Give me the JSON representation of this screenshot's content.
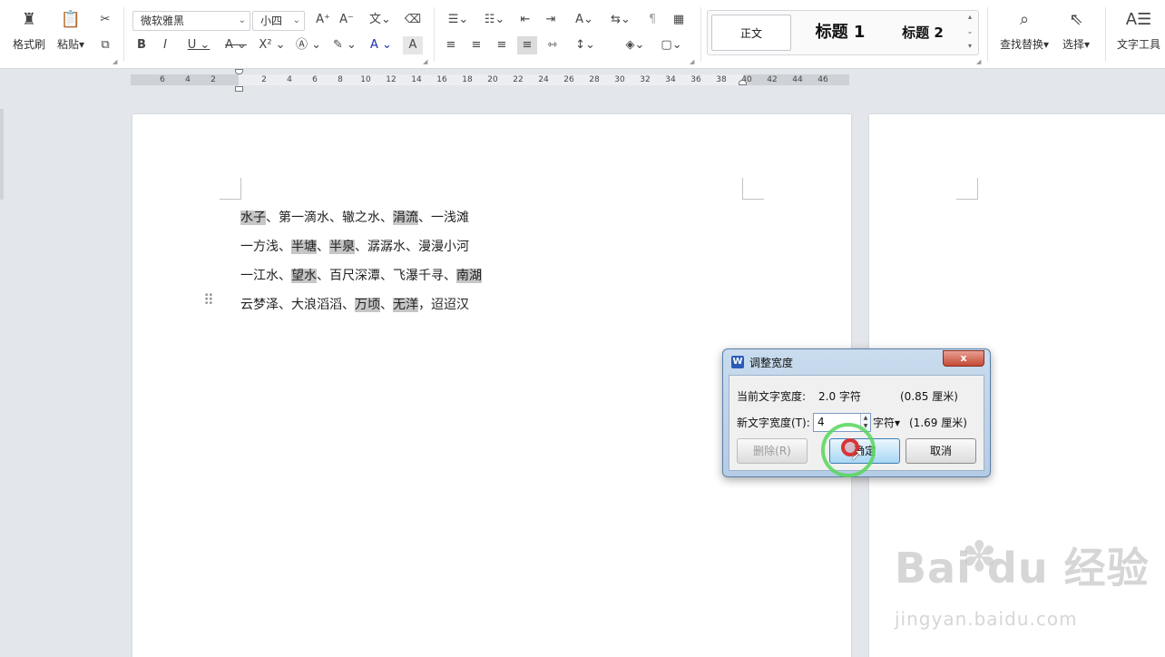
{
  "ribbon": {
    "format_painter": "格式刷",
    "paste": "粘贴",
    "font_name": "微软雅黑",
    "font_size": "小四",
    "styles": {
      "normal": "正文",
      "heading1": "标题 1",
      "heading2": "标题 2"
    },
    "find_replace": "查找替换",
    "select": "选择",
    "text_tools": "文字工具"
  },
  "ruler": {
    "ticks": [
      "6",
      "4",
      "2",
      "",
      "2",
      "4",
      "6",
      "8",
      "10",
      "12",
      "14",
      "16",
      "18",
      "20",
      "22",
      "24",
      "26",
      "28",
      "30",
      "32",
      "34",
      "36",
      "38",
      "40",
      "42",
      "44",
      "46"
    ]
  },
  "document": {
    "lines": [
      [
        {
          "t": "水子",
          "h": true
        },
        {
          "t": "、第一滴水、辙之水、",
          "h": false
        },
        {
          "t": "涓流",
          "h": true
        },
        {
          "t": "、一浅滩",
          "h": false
        }
      ],
      [
        {
          "t": "一方浅、",
          "h": false
        },
        {
          "t": "半塘",
          "h": true
        },
        {
          "t": "、",
          "h": false
        },
        {
          "t": "半泉",
          "h": true
        },
        {
          "t": "、潺潺水、漫漫小河",
          "h": false
        }
      ],
      [
        {
          "t": "一江水、",
          "h": false
        },
        {
          "t": "望水",
          "h": true
        },
        {
          "t": "、百尺深潭、飞瀑千寻、",
          "h": false
        },
        {
          "t": "南湖",
          "h": true
        }
      ],
      [
        {
          "t": "云梦泽、大浪滔滔、",
          "h": false
        },
        {
          "t": "万顷",
          "h": true
        },
        {
          "t": "、",
          "h": false
        },
        {
          "t": "无洋",
          "h": true
        },
        {
          "t": "，迢迢汉",
          "h": false
        }
      ]
    ]
  },
  "dialog": {
    "title": "调整宽度",
    "close": "x",
    "current_label": "当前文字宽度:",
    "current_value": "2.0 字符",
    "current_cm": "(0.85 厘米)",
    "new_label": "新文字宽度(T):",
    "new_value": "4",
    "unit": "字符",
    "new_cm": "(1.69 厘米)",
    "delete_btn": "删除(R)",
    "ok_btn": "确定",
    "cancel_btn": "取消"
  },
  "watermark": {
    "brand": "Bai du 经验",
    "url": "jingyan.baidu.com"
  }
}
